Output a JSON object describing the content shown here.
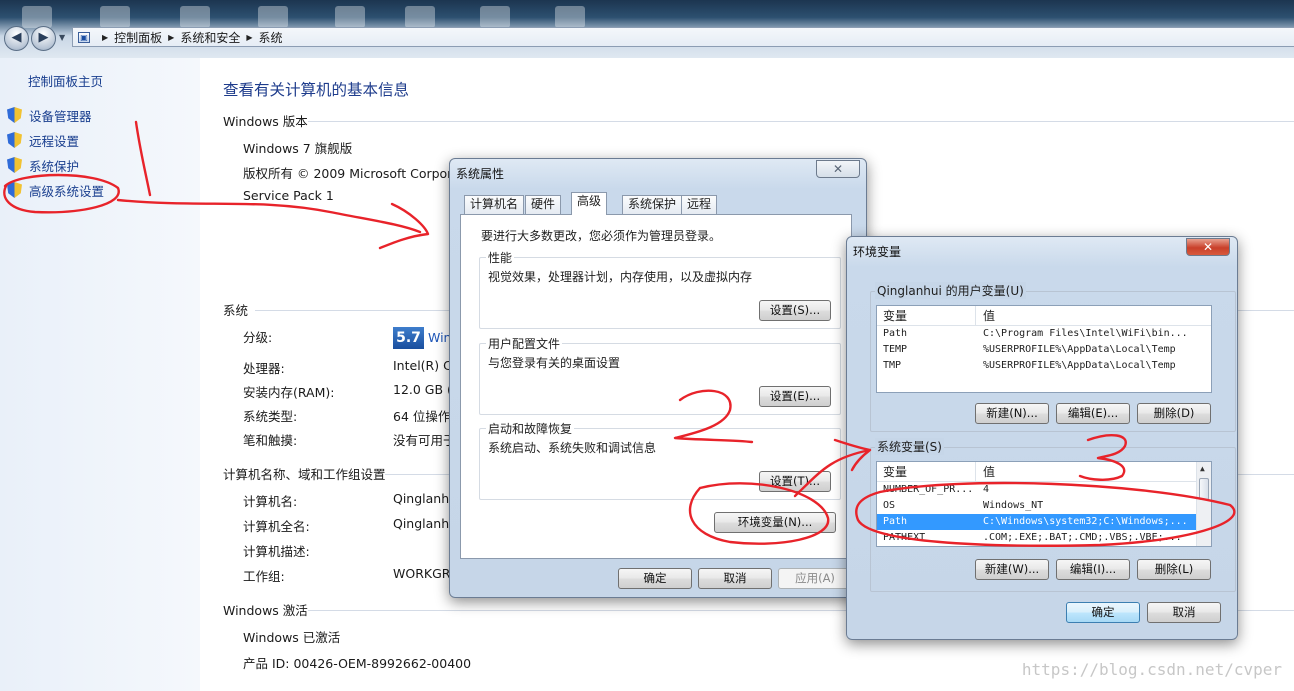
{
  "address_bar": {
    "breadcrumbs": [
      "控制面板",
      "系统和安全",
      "系统"
    ],
    "icon": "control-panel-icon"
  },
  "sidebar": {
    "home": "控制面板主页",
    "items": [
      {
        "label": "设备管理器",
        "icon": "shield-icon"
      },
      {
        "label": "远程设置",
        "icon": "shield-icon"
      },
      {
        "label": "系统保护",
        "icon": "shield-icon"
      },
      {
        "label": "高级系统设置",
        "icon": "shield-icon"
      }
    ]
  },
  "main": {
    "title": "查看有关计算机的基本信息",
    "edition": {
      "heading": "Windows 版本",
      "name": "Windows 7 旗舰版",
      "copyright": "版权所有 © 2009 Microsoft Corpora",
      "service_pack": "Service Pack 1"
    },
    "system": {
      "heading": "系统",
      "rows": [
        {
          "label": "分级:",
          "value": "Win"
        },
        {
          "label": "处理器:",
          "value": "Intel(R) Co"
        },
        {
          "label": "安装内存(RAM):",
          "value": "12.0 GB ("
        },
        {
          "label": "系统类型:",
          "value": "64 位操作"
        },
        {
          "label": "笔和触摸:",
          "value": "没有可用于"
        }
      ],
      "wei_score": "5.7"
    },
    "computer": {
      "heading": "计算机名称、域和工作组设置",
      "rows": [
        {
          "label": "计算机名:",
          "value": "Qinglanhu"
        },
        {
          "label": "计算机全名:",
          "value": "Qinglanhu"
        },
        {
          "label": "计算机描述:",
          "value": ""
        },
        {
          "label": "工作组:",
          "value": "WORKGR"
        }
      ]
    },
    "activation": {
      "heading": "Windows 激活",
      "status": "Windows 已激活",
      "product_id": "产品 ID: 00426-OEM-8992662-00400"
    }
  },
  "system_properties": {
    "title": "系统属性",
    "close": "✕",
    "tabs": [
      "计算机名",
      "硬件",
      "高级",
      "系统保护",
      "远程"
    ],
    "active_tab": "高级",
    "admin_note": "要进行大多数更改，您必须作为管理员登录。",
    "groups": [
      {
        "title": "性能",
        "desc": "视觉效果，处理器计划，内存使用，以及虚拟内存",
        "button": "设置(S)..."
      },
      {
        "title": "用户配置文件",
        "desc": "与您登录有关的桌面设置",
        "button": "设置(E)..."
      },
      {
        "title": "启动和故障恢复",
        "desc": "系统启动、系统失败和调试信息",
        "button": "设置(T)..."
      }
    ],
    "env_button": "环境变量(N)...",
    "ok": "确定",
    "cancel": "取消",
    "apply": "应用(A)"
  },
  "env_vars": {
    "title": "环境变量",
    "close": "✕",
    "user_group": "Qinglanhui 的用户变量(U)",
    "system_group": "系统变量(S)",
    "col_var": "变量",
    "col_val": "值",
    "user_rows": [
      {
        "name": "Path",
        "value": "C:\\Program Files\\Intel\\WiFi\\bin..."
      },
      {
        "name": "TEMP",
        "value": "%USERPROFILE%\\AppData\\Local\\Temp"
      },
      {
        "name": "TMP",
        "value": "%USERPROFILE%\\AppData\\Local\\Temp"
      }
    ],
    "system_rows": [
      {
        "name": "NUMBER_OF_PR...",
        "value": "4"
      },
      {
        "name": "OS",
        "value": "Windows_NT"
      },
      {
        "name": "Path",
        "value": "C:\\Windows\\system32;C:\\Windows;..."
      },
      {
        "name": "PATHEXT",
        "value": ".COM;.EXE;.BAT;.CMD;.VBS;.VBE;..."
      }
    ],
    "selected_system_row": 2,
    "user_buttons": {
      "new": "新建(N)...",
      "edit": "编辑(E)...",
      "delete": "删除(D)"
    },
    "system_buttons": {
      "new": "新建(W)...",
      "edit": "编辑(I)...",
      "delete": "删除(L)"
    },
    "ok": "确定",
    "cancel": "取消"
  },
  "annotations": {
    "step1": "1",
    "step2": "2",
    "step3": "3",
    "color": "#e8232a"
  },
  "watermark": "https://blog.csdn.net/cvper"
}
